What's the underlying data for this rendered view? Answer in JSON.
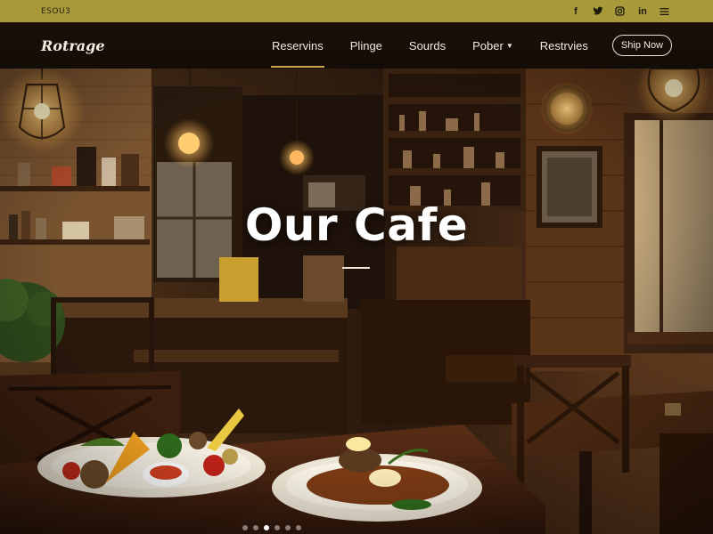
{
  "topbar": {
    "text": "ESOU3",
    "social": [
      "facebook-icon",
      "twitter-icon",
      "instagram-icon",
      "linkedin-icon",
      "menu-icon"
    ],
    "social_labels": {
      "facebook": "f",
      "linkedin": "in"
    }
  },
  "nav": {
    "logo": "Rotrage",
    "items": [
      "Reservins",
      "Plinge",
      "Sourds",
      "Pober",
      "Restrvies"
    ],
    "active_index": 0,
    "cta": "Ship Now"
  },
  "hero": {
    "title": "Our Cafe",
    "slides_total": 6,
    "slide_active": 2
  },
  "colors": {
    "topbar": "#a89a3a",
    "navbar": "#1a100a",
    "accent": "#c9a64a"
  }
}
